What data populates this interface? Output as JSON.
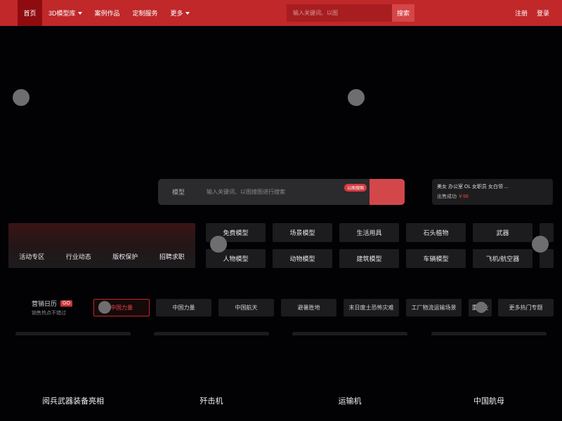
{
  "nav": {
    "items": [
      "首页",
      "3D模型库",
      "案例作品",
      "定制服务",
      "更多"
    ],
    "search_placeholder": "输入关键词、以图",
    "search_button": "搜索",
    "register": "注册",
    "login": "登录"
  },
  "hero_search": {
    "category": "模型",
    "placeholder": "输入关键词、以图搜图进行搜索",
    "badge": "以图搜图"
  },
  "ticker": {
    "title": "美女 办公室 OL 女职员 女白领 ...",
    "status": "出售成功",
    "price": "￥98"
  },
  "promo": {
    "links": [
      "活动专区",
      "行业动态",
      "版权保护",
      "招聘求职"
    ]
  },
  "categories": {
    "row1": [
      "免费模型",
      "场景模型",
      "生活用具",
      "石头植物",
      "武器"
    ],
    "row2": [
      "人物模型",
      "动物模型",
      "建筑模型",
      "车辆模型",
      "飞机/航空器"
    ]
  },
  "marketing": {
    "title": "营销日历",
    "go": "GO",
    "subtitle": "销售热点不错过",
    "topics": [
      "中国力量",
      "中国力量",
      "中国航天",
      "避暑胜地",
      "末日废土恐怖灾难",
      "工厂物流运输场景",
      "重工业",
      "更多热门专题"
    ]
  },
  "cards": {
    "labels": [
      "阅兵武器装备亮相",
      "歼击机",
      "运输机",
      "中国航母"
    ]
  },
  "colors": {
    "brand": "#c0282a",
    "background": "#020205",
    "tile": "#1c1c1e"
  }
}
